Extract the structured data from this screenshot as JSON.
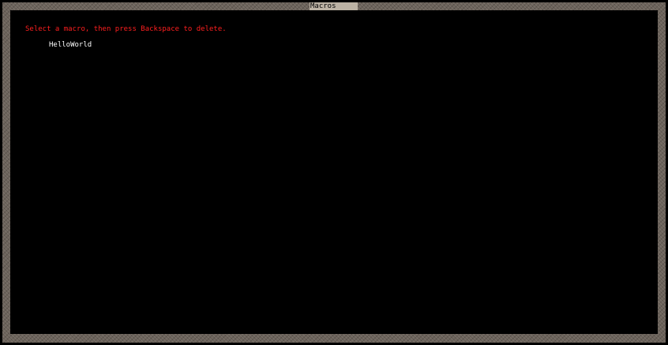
{
  "window": {
    "title": "Macros"
  },
  "instruction": {
    "text": "Select a macro, then press Backspace to delete.",
    "color": "#ff1f1f"
  },
  "macros": {
    "items": [
      {
        "label": "HelloWorld"
      }
    ],
    "text_color": "#ffffff"
  },
  "colors": {
    "background": "#000000",
    "border": "#6b625a",
    "title_tab": "#bcb2a4"
  }
}
